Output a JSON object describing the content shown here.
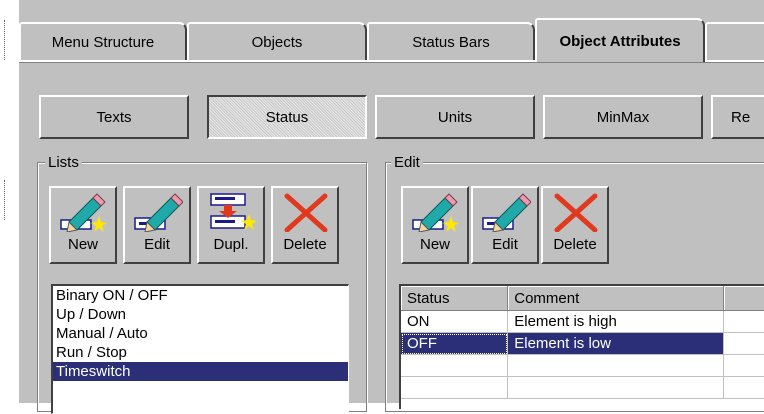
{
  "tabs": [
    {
      "label": "Menu Structure",
      "active": false
    },
    {
      "label": "Objects",
      "active": false
    },
    {
      "label": "Status Bars",
      "active": false
    },
    {
      "label": "Object Attributes",
      "active": true
    }
  ],
  "subtabs": [
    {
      "label": "Texts",
      "pressed": false
    },
    {
      "label": "Status",
      "pressed": true
    },
    {
      "label": "Units",
      "pressed": false
    },
    {
      "label": "MinMax",
      "pressed": false
    },
    {
      "label": "Re",
      "pressed": false
    }
  ],
  "lists_group": {
    "title": "Lists",
    "buttons": [
      {
        "label": "New",
        "icon": "pencil-new-icon"
      },
      {
        "label": "Edit",
        "icon": "pencil-edit-icon"
      },
      {
        "label": "Dupl.",
        "icon": "duplicate-icon"
      },
      {
        "label": "Delete",
        "icon": "delete-x-icon"
      }
    ],
    "items": [
      "Binary ON / OFF",
      "Up / Down",
      "Manual / Auto",
      "Run / Stop",
      "Timeswitch"
    ],
    "selected_index": 4
  },
  "edit_group": {
    "title": "Edit",
    "buttons": [
      {
        "label": "New",
        "icon": "pencil-new-icon"
      },
      {
        "label": "Edit",
        "icon": "pencil-edit-icon"
      },
      {
        "label": "Delete",
        "icon": "delete-x-icon"
      }
    ],
    "columns": [
      "Status",
      "Comment",
      ""
    ],
    "rows": [
      {
        "status": "ON",
        "comment": "Element is high",
        "selected": false
      },
      {
        "status": "OFF",
        "comment": "Element is low",
        "selected": true
      },
      {
        "status": "",
        "comment": "",
        "selected": false
      },
      {
        "status": "",
        "comment": "",
        "selected": false
      }
    ]
  },
  "colors": {
    "panel": "#c0c0c0",
    "selection": "#2b2f78",
    "icon_red": "#e0391d",
    "icon_teal": "#1fa9a9"
  }
}
